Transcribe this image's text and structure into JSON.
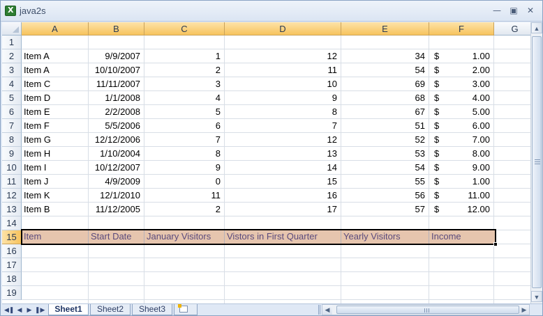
{
  "window": {
    "title": "java2s"
  },
  "columns": [
    "A",
    "B",
    "C",
    "D",
    "E",
    "F",
    "G"
  ],
  "selected_columns": [
    "A",
    "B",
    "C",
    "D",
    "E",
    "F"
  ],
  "rows": [
    "1",
    "2",
    "3",
    "4",
    "5",
    "6",
    "7",
    "8",
    "9",
    "10",
    "11",
    "12",
    "13",
    "14",
    "15",
    "16",
    "17",
    "18",
    "19"
  ],
  "selected_row": "15",
  "data_rows": [
    {
      "item": "Item A",
      "date": "9/9/2007",
      "jan": "1",
      "q1": "12",
      "yearly": "34",
      "cur": "$",
      "income": "1.00"
    },
    {
      "item": "Item A",
      "date": "10/10/2007",
      "jan": "2",
      "q1": "11",
      "yearly": "54",
      "cur": "$",
      "income": "2.00"
    },
    {
      "item": "Item C",
      "date": "11/11/2007",
      "jan": "3",
      "q1": "10",
      "yearly": "69",
      "cur": "$",
      "income": "3.00"
    },
    {
      "item": "Item D",
      "date": "1/1/2008",
      "jan": "4",
      "q1": "9",
      "yearly": "68",
      "cur": "$",
      "income": "4.00"
    },
    {
      "item": "Item E",
      "date": "2/2/2008",
      "jan": "5",
      "q1": "8",
      "yearly": "67",
      "cur": "$",
      "income": "5.00"
    },
    {
      "item": "Item F",
      "date": "5/5/2006",
      "jan": "6",
      "q1": "7",
      "yearly": "51",
      "cur": "$",
      "income": "6.00"
    },
    {
      "item": "Item G",
      "date": "12/12/2006",
      "jan": "7",
      "q1": "12",
      "yearly": "52",
      "cur": "$",
      "income": "7.00"
    },
    {
      "item": "Item H",
      "date": "1/10/2004",
      "jan": "8",
      "q1": "13",
      "yearly": "53",
      "cur": "$",
      "income": "8.00"
    },
    {
      "item": "Item I",
      "date": "10/12/2007",
      "jan": "9",
      "q1": "14",
      "yearly": "54",
      "cur": "$",
      "income": "9.00"
    },
    {
      "item": "Item J",
      "date": "4/9/2009",
      "jan": "0",
      "q1": "15",
      "yearly": "55",
      "cur": "$",
      "income": "1.00"
    },
    {
      "item": "Item K",
      "date": "12/1/2010",
      "jan": "11",
      "q1": "16",
      "yearly": "56",
      "cur": "$",
      "income": "11.00"
    },
    {
      "item": "Item B",
      "date": "11/12/2005",
      "jan": "2",
      "q1": "17",
      "yearly": "57",
      "cur": "$",
      "income": "12.00"
    }
  ],
  "header_row": {
    "item": "Item",
    "date": "Start Date",
    "jan": "January Visitors",
    "q1": "Vistors in First Quarter",
    "yearly": "Yearly Visitors",
    "income": "Income"
  },
  "sheet_tabs": [
    "Sheet1",
    "Sheet2",
    "Sheet3"
  ],
  "active_sheet": "Sheet1",
  "icons": {
    "app": "excel-icon",
    "minimize": "minimize-icon",
    "restore": "restore-icon",
    "close": "close-icon",
    "new_sheet": "insert-worksheet-icon"
  },
  "colors": {
    "selection_header": "#f7c35d",
    "header_row_fill": "#e6c5ae",
    "header_row_text": "#5a4a7c"
  }
}
